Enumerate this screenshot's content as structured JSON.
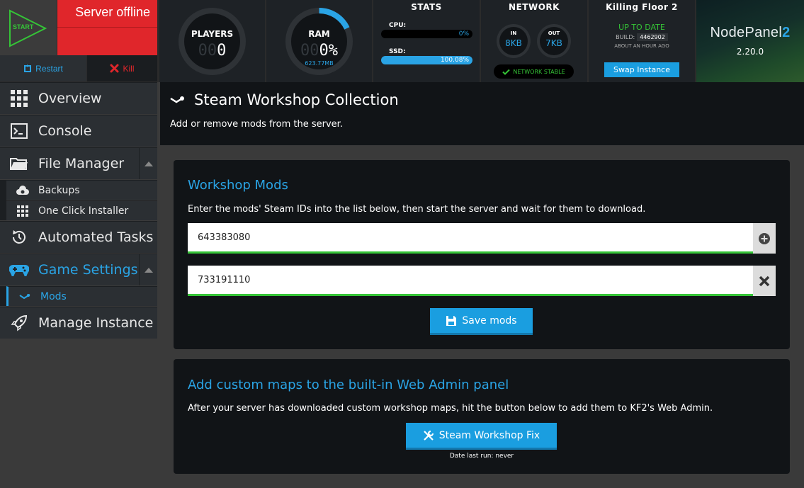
{
  "server": {
    "start_label": "START",
    "status": "Server offline",
    "restart_label": "Restart",
    "kill_label": "Kill"
  },
  "players": {
    "label": "PLAYERS",
    "ghost": "00",
    "value": "0"
  },
  "ram": {
    "label": "RAM",
    "ghost": "00",
    "value": "0%",
    "used": "623.77MB",
    "fill_fraction": 0.18
  },
  "stats": {
    "title": "STATS",
    "cpu_label": "CPU:",
    "cpu_value": "0%",
    "cpu_fraction": 0.0,
    "ssd_label": "SSD:",
    "ssd_value": "100.08%",
    "ssd_fraction": 1.0
  },
  "network": {
    "title": "NETWORK",
    "in_label": "IN",
    "in_value": "8KB",
    "out_label": "OUT",
    "out_value": "7KB",
    "status": "NETWORK STABLE"
  },
  "game": {
    "title": "Killing Floor 2",
    "status": "UP TO DATE",
    "build_label": "BUILD:",
    "build_value": "4462902",
    "updated": "ABOUT AN HOUR AGO",
    "swap_label": "Swap Instance"
  },
  "brand": {
    "name": "NodePanel",
    "name_suffix": "2",
    "version": "2.20.0"
  },
  "sidebar": {
    "overview": "Overview",
    "console": "Console",
    "file_manager": "File Manager",
    "backups": "Backups",
    "one_click": "One Click Installer",
    "automated_tasks": "Automated Tasks",
    "game_settings": "Game Settings",
    "mods": "Mods",
    "manage_instance": "Manage Instance"
  },
  "page": {
    "title": "Steam Workshop Collection",
    "subtitle": "Add or remove mods from the server."
  },
  "workshop": {
    "title": "Workshop Mods",
    "description": "Enter the mods' Steam IDs into the list below, then start the server and wait for them to download.",
    "mods": [
      "643383080",
      "733191110"
    ],
    "save_label": "Save mods"
  },
  "maps": {
    "title": "Add custom maps to the built-in Web Admin panel",
    "description": "After your server has downloaded custom workshop maps, hit the button below to add them to KF2's Web Admin.",
    "fix_label": "Steam Workshop Fix",
    "last_run": "Date last run: never"
  },
  "colors": {
    "accent": "#2aa4e5",
    "danger": "#e0262b",
    "success": "#35c437"
  }
}
